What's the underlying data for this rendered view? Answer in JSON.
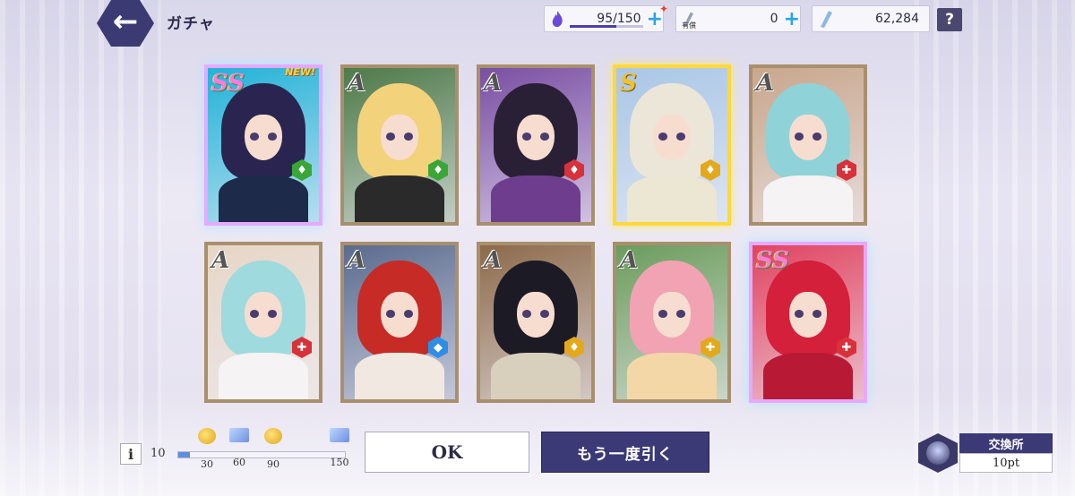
{
  "header": {
    "back_icon": "arrow-left-icon",
    "title": "ガチャ",
    "stamina": {
      "value": "95/150",
      "fill_fraction": 0.63,
      "icon": "flame-icon"
    },
    "paid_gems": {
      "label": "有償",
      "value": "0",
      "icon": "crystal-icon"
    },
    "free_gems": {
      "value": "62,284",
      "icon": "crystal-icon"
    },
    "help_label": "?"
  },
  "cards": [
    {
      "rank": "SS",
      "new": "NEW!",
      "badge": "green",
      "badge_icon": "sword-icon",
      "hair": "#2a2450",
      "body": "#1d2a4a",
      "bg": "#22b3d8"
    },
    {
      "rank": "A",
      "new": "",
      "badge": "green",
      "badge_icon": "sword-icon",
      "hair": "#f2d27a",
      "body": "#2a2a2a",
      "bg": "#4e7a48"
    },
    {
      "rank": "A",
      "new": "",
      "badge": "red",
      "badge_icon": "sword-icon",
      "hair": "#2a2036",
      "body": "#6e3d8e",
      "bg": "#7a4fa3"
    },
    {
      "rank": "S",
      "new": "",
      "badge": "gold",
      "badge_icon": "sword-icon",
      "hair": "#ebe6d8",
      "body": "#ece7d3",
      "bg": "#a9c7e6"
    },
    {
      "rank": "A",
      "new": "",
      "badge": "red",
      "badge_icon": "cross-icon",
      "hair": "#8fd3d8",
      "body": "#f5f3f3",
      "bg": "#c9a78c"
    },
    {
      "rank": "A",
      "new": "",
      "badge": "red",
      "badge_icon": "cross-icon",
      "hair": "#9fdade",
      "body": "#f5f3f3",
      "bg": "#e6d6c6"
    },
    {
      "rank": "A",
      "new": "",
      "badge": "blue",
      "badge_icon": "shield-icon",
      "hair": "#c62b26",
      "body": "#f1e8e2",
      "bg": "#5a6b8e"
    },
    {
      "rank": "A",
      "new": "",
      "badge": "gold",
      "badge_icon": "sword-icon",
      "hair": "#1c1a24",
      "body": "#d9cfbd",
      "bg": "#8c6a4a"
    },
    {
      "rank": "A",
      "new": "",
      "badge": "gold",
      "badge_icon": "cross-icon",
      "hair": "#f1a3b3",
      "body": "#f3d7a7",
      "bg": "#6b9c5c"
    },
    {
      "rank": "SS",
      "new": "",
      "badge": "red",
      "badge_icon": "cross-icon",
      "hair": "#d4203a",
      "body": "#b81a36",
      "bg": "#e04460"
    }
  ],
  "progress": {
    "info_label": "i",
    "count": "10",
    "fill_fraction": 0.07,
    "milestones": [
      {
        "value": "30",
        "icon": "coin-icon"
      },
      {
        "value": "60",
        "icon": "ticket-icon"
      },
      {
        "value": "90",
        "icon": "coin-icon"
      },
      {
        "value": "150",
        "icon": "ticket-icon"
      }
    ]
  },
  "buttons": {
    "ok": "OK",
    "again": "もう一度引く"
  },
  "exchange": {
    "label": "交換所",
    "points": "10pt"
  }
}
